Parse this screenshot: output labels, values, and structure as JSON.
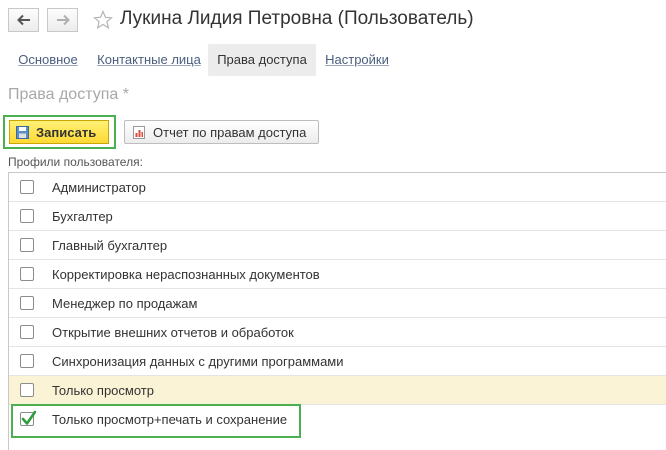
{
  "window": {
    "title": "Лукина Лидия Петровна (Пользователь)"
  },
  "tabs": [
    {
      "label": "Основное"
    },
    {
      "label": "Контактные лица"
    },
    {
      "label": "Права доступа"
    },
    {
      "label": "Настройки"
    }
  ],
  "section": {
    "title": "Права доступа *"
  },
  "toolbar": {
    "save_label": "Записать",
    "report_label": "Отчет по правам доступа"
  },
  "profiles": {
    "label": "Профили пользователя:",
    "items": [
      {
        "label": "Администратор",
        "checked": false
      },
      {
        "label": "Бухгалтер",
        "checked": false
      },
      {
        "label": "Главный бухгалтер",
        "checked": false
      },
      {
        "label": "Корректировка нераспознанных документов",
        "checked": false
      },
      {
        "label": "Менеджер по продажам",
        "checked": false
      },
      {
        "label": "Открытие внешних отчетов и обработок",
        "checked": false
      },
      {
        "label": "Синхронизация данных с другими программами",
        "checked": false
      },
      {
        "label": "Только просмотр",
        "checked": false
      },
      {
        "label": "Только просмотр+печать и сохранение",
        "checked": true
      }
    ]
  },
  "colors": {
    "highlight": "#4caf50",
    "accent_button": "#fdd835",
    "selected_row": "#fbf3d6"
  }
}
